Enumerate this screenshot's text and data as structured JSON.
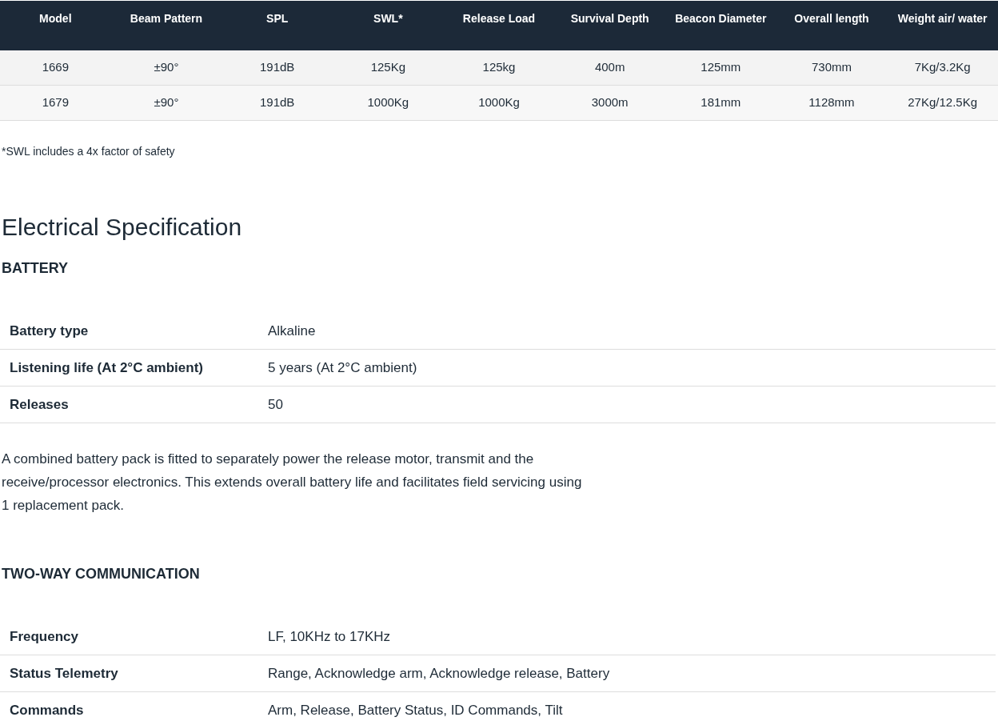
{
  "models_table": {
    "columns": [
      "Model",
      "Beam Pattern",
      "SPL",
      "SWL*",
      "Release Load",
      "Survival Depth",
      "Beacon Diameter",
      "Overall length",
      "Weight air/ water"
    ],
    "rows": [
      [
        "1669",
        "±90°",
        "191dB",
        "125Kg",
        "125kg",
        "400m",
        "125mm",
        "730mm",
        "7Kg/3.2Kg"
      ],
      [
        "1679",
        "±90°",
        "191dB",
        "1000Kg",
        "1000Kg",
        "3000m",
        "181mm",
        "1128mm",
        "27Kg/12.5Kg"
      ]
    ]
  },
  "footnote": "*SWL includes a 4x factor of safety",
  "heading": "Electrical Specification",
  "sections": [
    {
      "title": "BATTERY",
      "rows": [
        {
          "label": "Battery type",
          "value": "Alkaline"
        },
        {
          "label": "Listening life (At 2°C ambient)",
          "value": "5 years (At 2°C ambient)"
        },
        {
          "label": "Releases",
          "value": "50"
        }
      ],
      "paragraph": "A combined battery pack is fitted to separately power the release motor, transmit and the receive/processor electronics. This extends overall battery life and facilitates field servicing using 1 replacement pack."
    },
    {
      "title": "TWO-WAY COMMUNICATION",
      "rows": [
        {
          "label": "Frequency",
          "value": "LF, 10KHz to 17KHz"
        },
        {
          "label": "Status Telemetry",
          "value": "Range, Acknowledge arm, Acknowledge release, Battery"
        },
        {
          "label": "Commands",
          "value": "Arm, Release, Battery Status, ID Commands, Tilt"
        }
      ]
    }
  ]
}
